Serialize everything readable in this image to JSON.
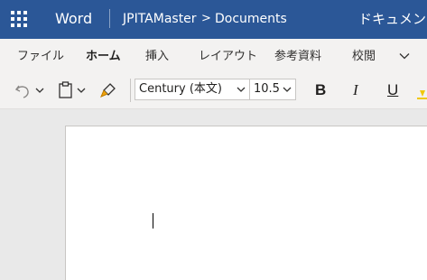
{
  "header": {
    "app_name": "Word",
    "breadcrumb": [
      "JPITAMaster",
      "Documents"
    ],
    "breadcrumb_separator": ">",
    "document_title": "ドキュメント",
    "bar_color": "#2b5797"
  },
  "ribbon": {
    "tabs": [
      "ファイル",
      "ホーム",
      "挿入",
      "レイアウト",
      "参考資料",
      "校閲"
    ],
    "active_tab": "ホーム"
  },
  "toolbar": {
    "font_name": "Century (本文)",
    "font_size": "10.5",
    "bold_label": "B",
    "italic_label": "I",
    "underline_label": "U",
    "icons": [
      "undo-icon",
      "paste-icon",
      "format-painter-icon"
    ]
  }
}
